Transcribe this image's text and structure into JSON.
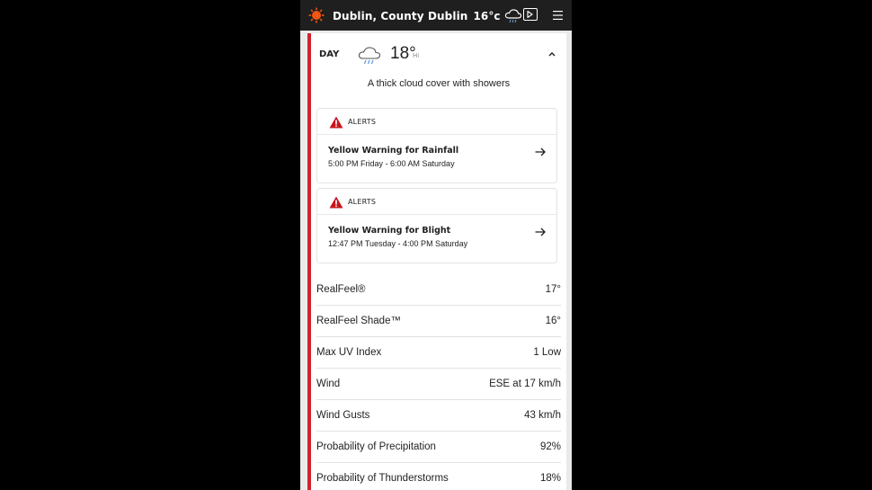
{
  "header": {
    "location": "Dublin, County Dublin",
    "current_temp": "16°c",
    "logo_icon": "sun-logo-icon",
    "weather_icon": "cloud-rain-icon",
    "video_icon": "play-icon",
    "menu_icon": "menu-icon"
  },
  "day": {
    "label": "DAY",
    "temp": "18°",
    "hi_label": "Hi",
    "phrase": "A thick cloud cover with showers",
    "icon": "cloud-rain-icon"
  },
  "alerts": [
    {
      "kind": "ALERTS",
      "title": "Yellow Warning for Rainfall",
      "time": "5:00 PM Friday - 6:00 AM Saturday"
    },
    {
      "kind": "ALERTS",
      "title": "Yellow Warning for Blight",
      "time": "12:47 PM Tuesday - 4:00 PM Saturday"
    }
  ],
  "details": [
    {
      "label": "RealFeel®",
      "value": "17°"
    },
    {
      "label": "RealFeel Shade™",
      "value": "16°"
    },
    {
      "label": "Max UV Index",
      "value": "1 Low"
    },
    {
      "label": "Wind",
      "value": "ESE at 17 km/h"
    },
    {
      "label": "Wind Gusts",
      "value": "43 km/h"
    },
    {
      "label": "Probability of Precipitation",
      "value": "92%"
    },
    {
      "label": "Probability of Thunderstorms",
      "value": "18%"
    }
  ],
  "colors": {
    "accent": "#d1222b",
    "header_bg": "#1f1f1f",
    "logo": "#f05514"
  }
}
